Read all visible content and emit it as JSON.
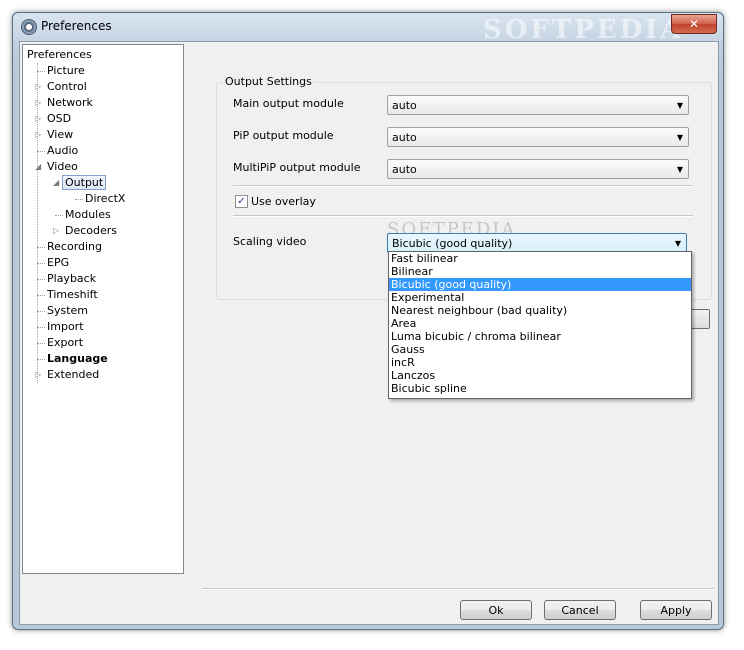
{
  "window": {
    "title": "Preferences",
    "close_label": "✕",
    "watermark": "SOFTPEDIA"
  },
  "tree": {
    "root": "Preferences",
    "items": [
      {
        "label": "Picture"
      },
      {
        "label": "Control",
        "expandable": true
      },
      {
        "label": "Network",
        "expandable": true
      },
      {
        "label": "OSD",
        "expandable": true
      },
      {
        "label": "View",
        "expandable": true
      },
      {
        "label": "Audio"
      },
      {
        "label": "Video",
        "expanded": true
      },
      {
        "label": "Output",
        "expanded": true,
        "selected": true
      },
      {
        "label": "DirectX"
      },
      {
        "label": "Modules"
      },
      {
        "label": "Decoders",
        "expandable": true
      },
      {
        "label": "Recording"
      },
      {
        "label": "EPG"
      },
      {
        "label": "Playback"
      },
      {
        "label": "Timeshift"
      },
      {
        "label": "System"
      },
      {
        "label": "Import"
      },
      {
        "label": "Export"
      },
      {
        "label": "Language",
        "bold": true
      },
      {
        "label": "Extended",
        "expandable": true
      }
    ]
  },
  "output_settings": {
    "group_title": "Output Settings",
    "main_output_label": "Main output module",
    "main_output_value": "auto",
    "pip_output_label": "PiP output module",
    "pip_output_value": "auto",
    "multipip_output_label": "MultiPiP output module",
    "multipip_output_value": "auto",
    "use_overlay_label": "Use overlay",
    "use_overlay_checked": true,
    "scaling_label": "Scaling video",
    "scaling_value": "Bicubic (good quality)",
    "scaling_options": [
      "Fast bilinear",
      "Bilinear",
      "Bicubic (good quality)",
      "Experimental",
      "Nearest neighbour (bad quality)",
      "Area",
      "Luma bicubic / chroma bilinear",
      "Gauss",
      "incR",
      "Lanczos",
      "Bicubic spline"
    ],
    "inner_watermark": "SOFTPEDIA"
  },
  "buttons": {
    "ok": "Ok",
    "cancel": "Cancel",
    "apply": "Apply"
  },
  "icons": {
    "check": "✓",
    "combo_arrow": "▼",
    "collapsed": "▷",
    "expanded": "◢"
  }
}
